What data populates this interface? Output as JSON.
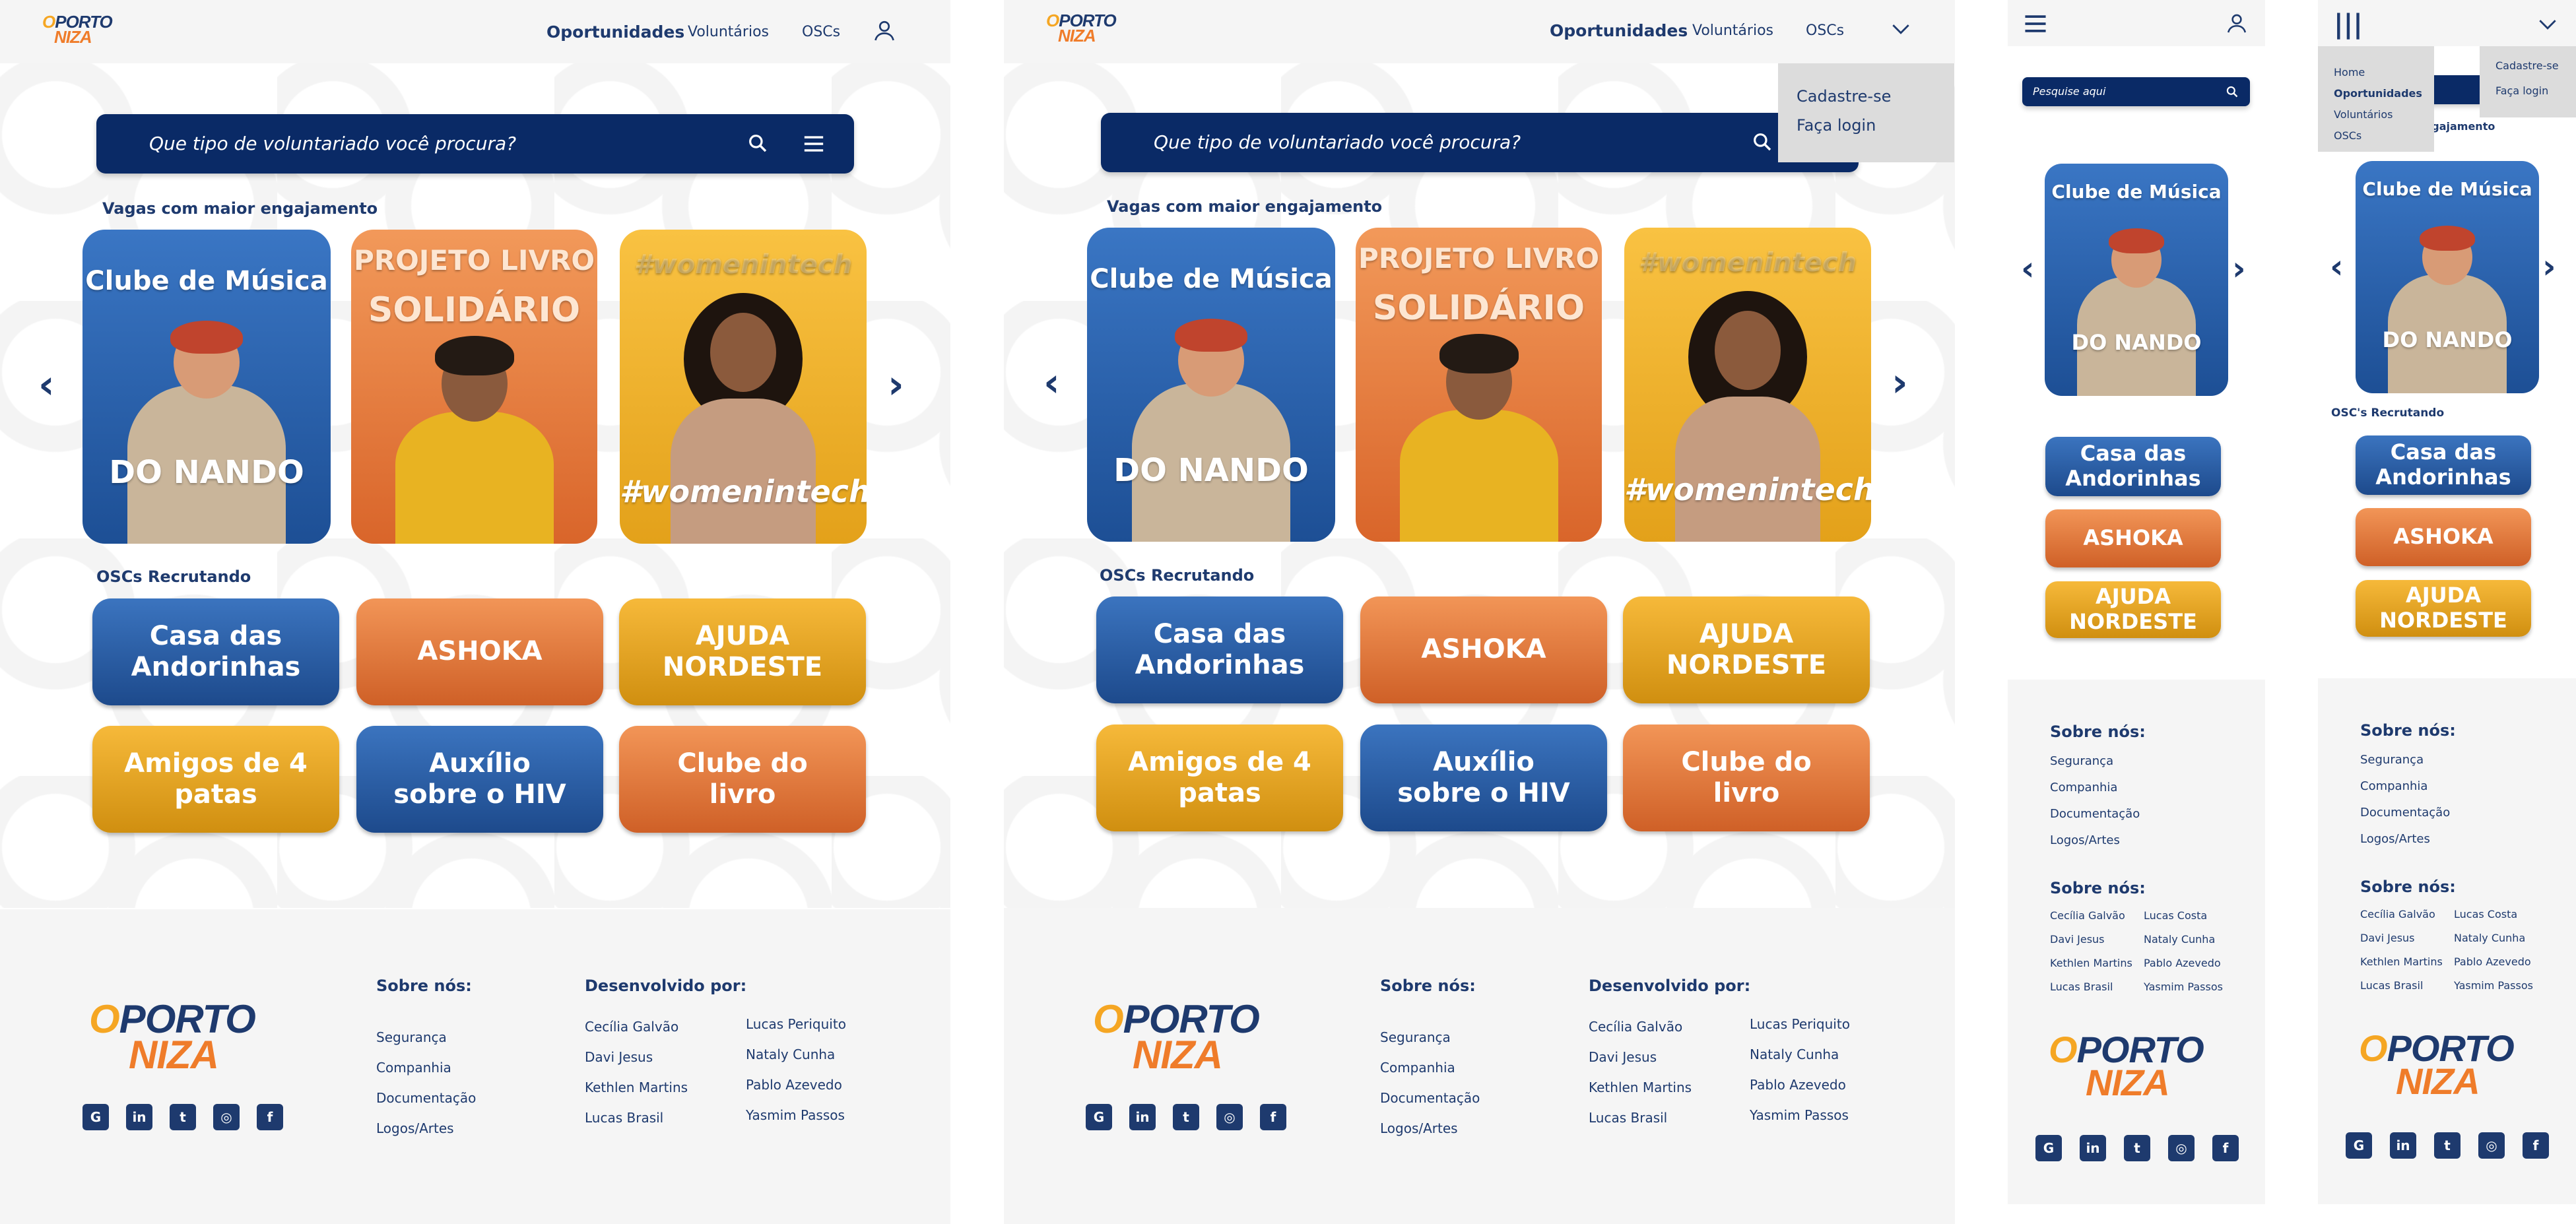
{
  "brand": {
    "line1": "O PORTO",
    "line1_o": "O",
    "line1_rest": "PORTO",
    "line2": "NIZA"
  },
  "nav": {
    "oportunidades": "Oportunidades",
    "voluntarios": "Voluntários",
    "oscs": "OSCs"
  },
  "search": {
    "placeholder": "Que tipo de voluntariado você procura?",
    "mobile_placeholder": "Pesquise aqui"
  },
  "sections": {
    "vagas": "Vagas com maior engajamento",
    "oscs": "OSCs Recrutando",
    "oscs_mobile": "OSC's Recrutando"
  },
  "cards": [
    {
      "top": "Clube de Música",
      "bottom": "DO NANDO"
    },
    {
      "top": "PROJETO LIVRO",
      "bottom": "SOLIDÁRIO"
    },
    {
      "top": "#womenintech",
      "bottom": "#womenintech"
    }
  ],
  "oscs": [
    {
      "l1": "Casa das",
      "l2": "Andorinhas"
    },
    {
      "l1": "ASHOKA",
      "l2": ""
    },
    {
      "l1": "AJUDA",
      "l2": "NORDESTE"
    },
    {
      "l1": "Amigos de 4",
      "l2": "patas"
    },
    {
      "l1": "Auxílio",
      "l2": "sobre o HIV"
    },
    {
      "l1": "Clube do",
      "l2": "livro"
    }
  ],
  "footer": {
    "sobre_title": "Sobre nós:",
    "sobre": [
      "Segurança",
      "Companhia",
      "Documentação",
      "Logos/Artes"
    ],
    "dev_title": "Desenvolvido por:",
    "dev_col1": [
      "Cecília Galvão",
      "Davi Jesus",
      "Kethlen Martins",
      "Lucas Brasil"
    ],
    "dev_col2": [
      "Lucas Periquito",
      "Nataly Cunha",
      "Pablo Azevedo",
      "Yasmim Passos"
    ],
    "mobile_col2": [
      "Lucas Costa",
      "Nataly Cunha",
      "Pablo Azevedo",
      "Yasmim Passos"
    ],
    "mobile_title2": "Sobre nós:",
    "social": [
      "github-icon",
      "linkedin-icon",
      "twitter-icon",
      "instagram-icon",
      "facebook-icon"
    ]
  },
  "account_menu": {
    "cadastre": "Cadastre-se",
    "login": "Faça login"
  },
  "mobile_menu": {
    "items": [
      "Home",
      "Oportunidades",
      "Voluntários",
      "OSCs"
    ]
  },
  "colors": {
    "navy": "#0a2a66",
    "blue": "#1e3a6e",
    "orange": "#ef7c2a",
    "yellow": "#f5a623"
  }
}
